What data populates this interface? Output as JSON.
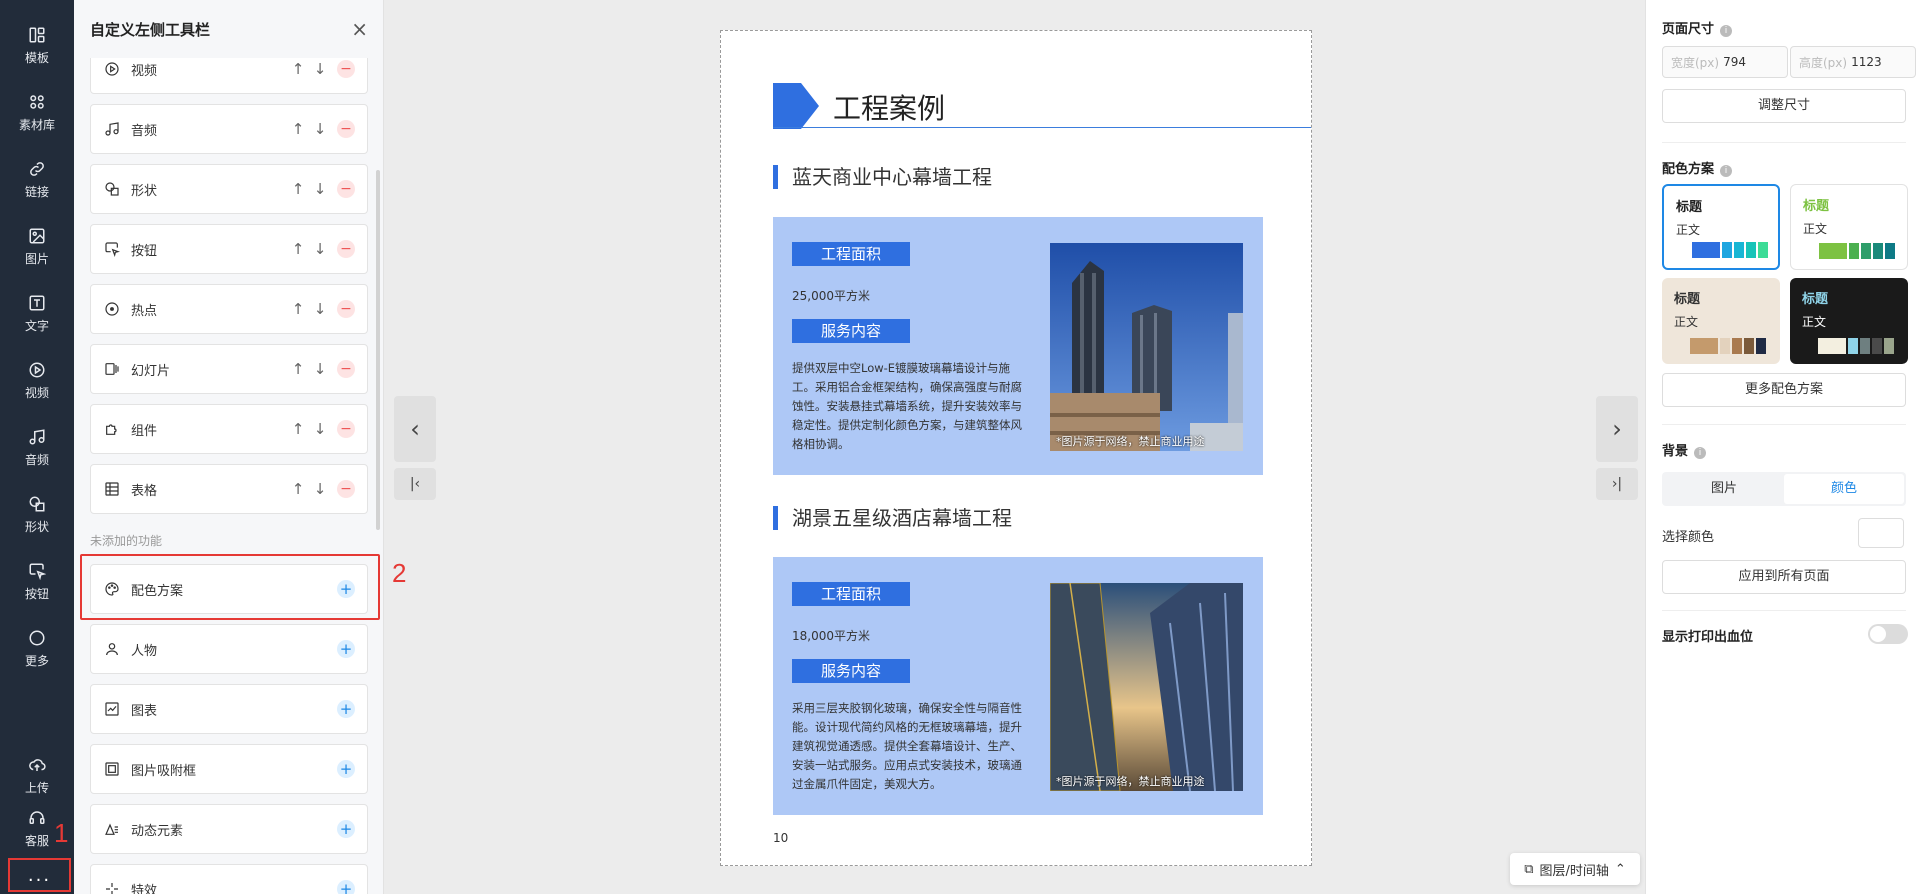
{
  "rail": {
    "items": [
      {
        "label": "模板",
        "icon": "template-icon"
      },
      {
        "label": "素材库",
        "icon": "library-icon"
      },
      {
        "label": "链接",
        "icon": "link-icon"
      },
      {
        "label": "图片",
        "icon": "image-icon"
      },
      {
        "label": "文字",
        "icon": "text-icon"
      },
      {
        "label": "视频",
        "icon": "video-icon"
      },
      {
        "label": "音频",
        "icon": "audio-icon"
      },
      {
        "label": "形状",
        "icon": "shape-icon"
      },
      {
        "label": "按钮",
        "icon": "button-icon"
      },
      {
        "label": "更多",
        "icon": "more-icon"
      }
    ],
    "upload": "上传",
    "service": "客服",
    "dots": "..."
  },
  "annotations": {
    "one": "1",
    "two": "2"
  },
  "toolbar_panel": {
    "title": "自定义左侧工具栏",
    "close": "×",
    "added": [
      {
        "label": "视频"
      },
      {
        "label": "音频"
      },
      {
        "label": "形状"
      },
      {
        "label": "按钮"
      },
      {
        "label": "热点"
      },
      {
        "label": "幻灯片"
      },
      {
        "label": "组件"
      },
      {
        "label": "表格"
      }
    ],
    "section_label": "未添加的功能",
    "not_added": [
      {
        "label": "配色方案"
      },
      {
        "label": "人物"
      },
      {
        "label": "图表"
      },
      {
        "label": "图片吸附框"
      },
      {
        "label": "动态元素"
      },
      {
        "label": "特效"
      }
    ]
  },
  "page": {
    "title": "工程案例",
    "cases": [
      {
        "name": "蓝天商业中心幕墙工程",
        "area_tag": "工程面积",
        "area": "25,000平方米",
        "service_tag": "服务内容",
        "desc": "提供双层中空Low-E镀膜玻璃幕墙设计与施工。采用铝合金框架结构，确保高强度与耐腐蚀性。安装悬挂式幕墙系统，提升安装效率与稳定性。提供定制化颜色方案，与建筑整体风格相协调。",
        "caption": "*图片源于网络，禁止商业用途"
      },
      {
        "name": "湖景五星级酒店幕墙工程",
        "area_tag": "工程面积",
        "area": "18,000平方米",
        "service_tag": "服务内容",
        "desc": "采用三层夹胶钢化玻璃，确保安全性与隔音性能。设计现代简约风格的无框玻璃幕墙，提升建筑视觉通透感。提供全套幕墙设计、生产、安装一站式服务。应用点式安装技术，玻璃通过金属爪件固定，美观大方。",
        "caption": "*图片源于网络，禁止商业用途"
      }
    ],
    "page_number": "10"
  },
  "layer_button": "图层/时间轴",
  "right_panel": {
    "page_size": {
      "label": "页面尺寸",
      "width_placeholder": "宽度(px)",
      "width": "794",
      "height_placeholder": "高度(px)",
      "height": "1123",
      "adjust": "调整尺寸"
    },
    "color_scheme": {
      "label": "配色方案",
      "schemes": [
        {
          "title": "标题",
          "body": "正文",
          "title_color": "#222222",
          "body_color": "#333333",
          "bg": "#ffffff",
          "swatches": [
            "#2f6fe0",
            "#1fa6e0",
            "#18b6d4",
            "#17c4b8",
            "#3ddc97"
          ]
        },
        {
          "title": "标题",
          "body": "正文",
          "title_color": "#7dc242",
          "body_color": "#333333",
          "bg": "#ffffff",
          "swatches": [
            "#7dc242",
            "#4cb050",
            "#2e9e6a",
            "#1a8a7a",
            "#0e7a86"
          ]
        },
        {
          "title": "标题",
          "body": "正文",
          "title_color": "#333333",
          "body_color": "#333333",
          "bg": "#efe6da",
          "swatches": [
            "#c49a6c",
            "#e3d2bd",
            "#a97a4f",
            "#7b5a3a",
            "#1f2a44"
          ]
        },
        {
          "title": "标题",
          "body": "正文",
          "title_color": "#8fd3e8",
          "body_color": "#ffffff",
          "bg": "#1a1a1a",
          "swatches": [
            "#f3efe0",
            "#8fd3e8",
            "#6e7f80",
            "#4a4a4a",
            "#9aa58c"
          ]
        }
      ],
      "more": "更多配色方案"
    },
    "background": {
      "label": "背景",
      "tab_image": "图片",
      "tab_color": "颜色",
      "choose_color": "选择颜色",
      "apply_all": "应用到所有页面"
    },
    "bleed": {
      "label": "显示打印出血位"
    }
  }
}
